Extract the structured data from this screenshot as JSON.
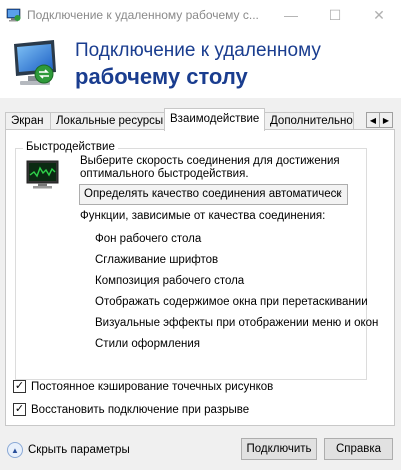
{
  "window": {
    "title": "Подключение к удаленному рабочему с...",
    "min_glyph": "—",
    "max_glyph": "☐",
    "close_glyph": "✕"
  },
  "banner": {
    "title_line1": "Подключение к удаленному",
    "title_line2": "рабочему столу",
    "icon": "remote-desktop-icon"
  },
  "tabs": [
    {
      "label": "Экран"
    },
    {
      "label": "Локальные ресурсы"
    },
    {
      "label": "Взаимодействие",
      "active": true
    },
    {
      "label": "Дополнительно"
    }
  ],
  "tab_scroll": {
    "left": "◀",
    "right": "▶"
  },
  "performance": {
    "group_label": "Быстродействие",
    "description": "Выберите скорость соединения для достижения оптимального быстродействия.",
    "connection_select": "Определять качество соединения автоматическ",
    "features_label": "Функции, зависимые от качества соединения:",
    "features": [
      "Фон рабочего стола",
      "Сглаживание шрифтов",
      "Композиция рабочего стола",
      "Отображать содержимое окна при перетаскивании",
      "Визуальные эффекты при отображении меню и окон",
      "Стили оформления"
    ]
  },
  "options": {
    "bitmap_cache": {
      "label": "Постоянное кэширование точечных рисунков",
      "checked": true
    },
    "reconnect": {
      "label": "Восстановить подключение при разрыве",
      "checked": true
    }
  },
  "footer": {
    "hide_params": "Скрыть параметры",
    "connect": "Подключить",
    "help": "Справка"
  },
  "colors": {
    "title_blue": "#1a3d8f",
    "background": "#f0f0f0"
  }
}
